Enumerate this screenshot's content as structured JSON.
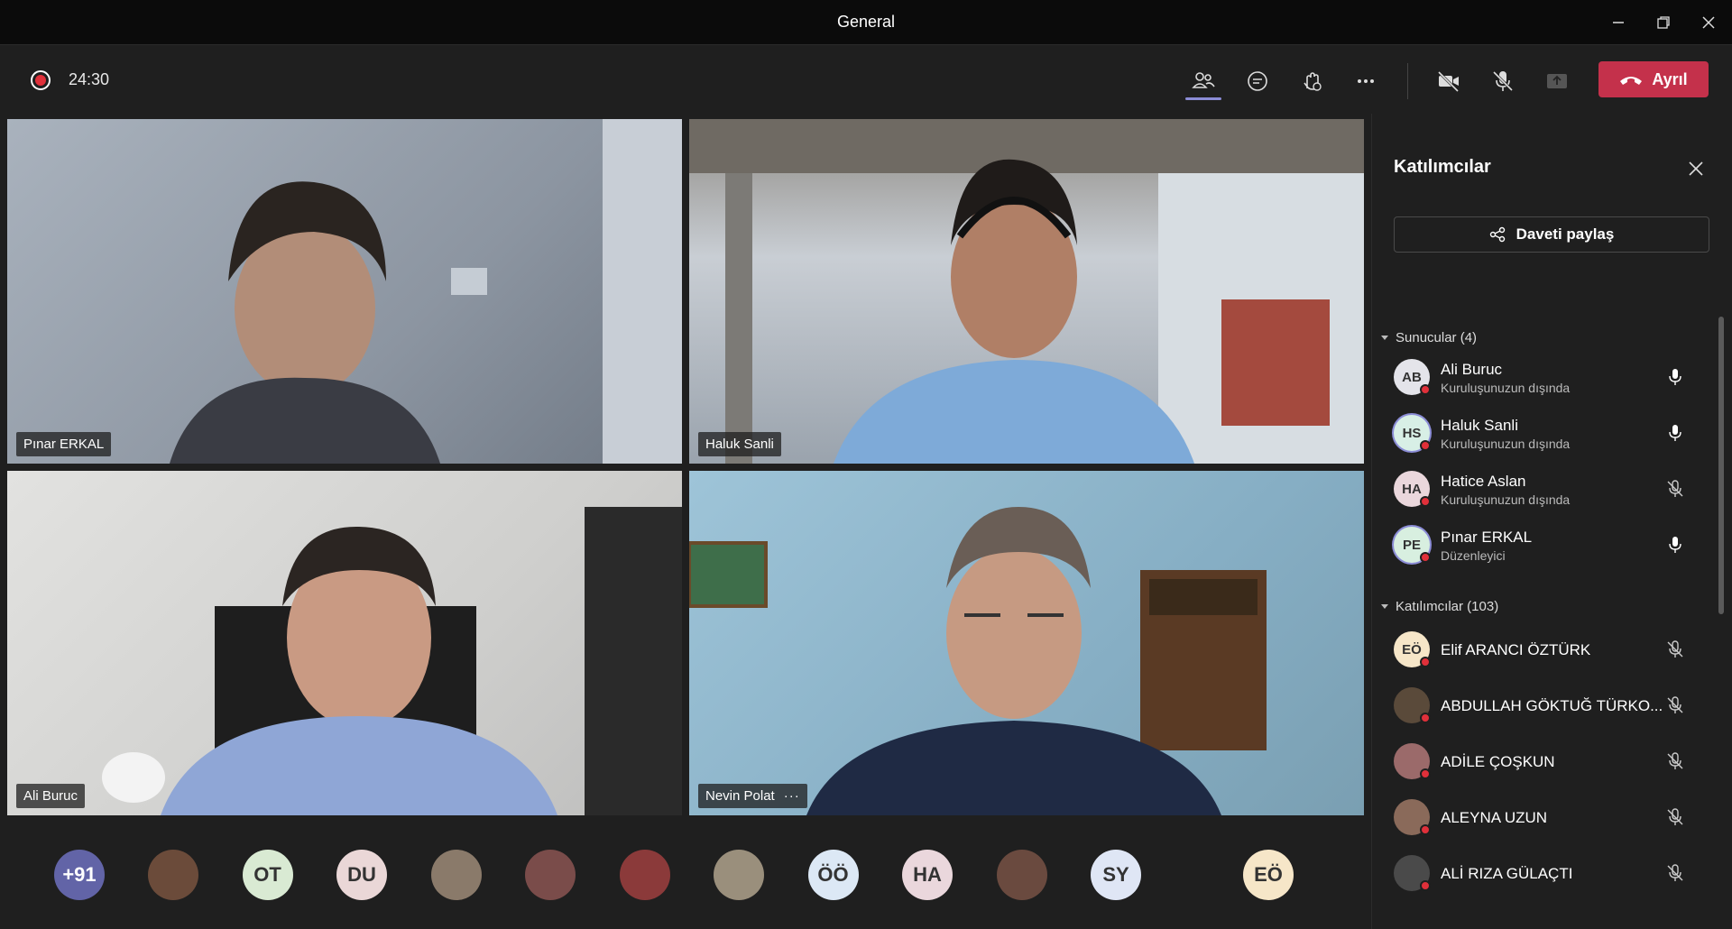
{
  "window": {
    "title": "General"
  },
  "toolbar": {
    "timer": "24:30",
    "leave_label": "Ayrıl"
  },
  "videos": [
    {
      "name": "Pınar ERKAL",
      "bg": "#9aa2ad"
    },
    {
      "name": "Haluk Sanli",
      "bg": "#b9bec4"
    },
    {
      "name": "Ali Buruc",
      "bg": "#cfcfcf"
    },
    {
      "name": "Nevin Polat",
      "bg": "#8fb1c4",
      "more": "···"
    }
  ],
  "strip": {
    "overflow": "+91",
    "avatars": [
      {
        "initials": "",
        "color": "#6b4b3a"
      },
      {
        "initials": "OT",
        "color": "#d9ead3"
      },
      {
        "initials": "DU",
        "color": "#ead7d7"
      },
      {
        "initials": "",
        "color": "#8a7a6a"
      },
      {
        "initials": "",
        "color": "#7a4c4a"
      },
      {
        "initials": "",
        "color": "#8b3a3a"
      },
      {
        "initials": "",
        "color": "#9a8f7c"
      },
      {
        "initials": "ÖÖ",
        "color": "#dce8f5"
      },
      {
        "initials": "HA",
        "color": "#ead7dc"
      },
      {
        "initials": "",
        "color": "#6a4a3f"
      },
      {
        "initials": "SY",
        "color": "#dfe6f5"
      }
    ],
    "self_initials": "EÖ"
  },
  "panel": {
    "title": "Katılımcılar",
    "share_label": "Daveti paylaş",
    "presenters_header": "Sunucular (4)",
    "attendees_header": "Katılımcılar (103)",
    "presenters": [
      {
        "initials": "AB",
        "name": "Ali Buruc",
        "sub": "Kuruluşunuzun dışında",
        "color": "#e4e4ea",
        "ring": false,
        "mic": "on"
      },
      {
        "initials": "HS",
        "name": "Haluk Sanli",
        "sub": "Kuruluşunuzun dışında",
        "color": "#d8efe6",
        "ring": true,
        "mic": "on"
      },
      {
        "initials": "HA",
        "name": "Hatice Aslan",
        "sub": "Kuruluşunuzun dışında",
        "color": "#ead7dc",
        "ring": false,
        "mic": "off"
      },
      {
        "initials": "PE",
        "name": "Pınar ERKAL",
        "sub": "Düzenleyici",
        "color": "#d8efe0",
        "ring": true,
        "mic": "on"
      }
    ],
    "attendees": [
      {
        "initials": "EÖ",
        "name": "Elif ARANCI ÖZTÜRK",
        "color": "#f6e6c8",
        "mic": "off"
      },
      {
        "initials": "",
        "name": "ABDULLAH GÖKTUĞ TÜRKO...",
        "color": "#5a4a3a",
        "mic": "off"
      },
      {
        "initials": "",
        "name": "ADİLE ÇOŞKUN",
        "color": "#9b6a6a",
        "mic": "off"
      },
      {
        "initials": "",
        "name": "ALEYNA UZUN",
        "color": "#8a6a5a",
        "mic": "off"
      },
      {
        "initials": "",
        "name": "ALİ RIZA GÜLAÇTI",
        "color": "#4a4a4a",
        "mic": "off"
      }
    ]
  }
}
